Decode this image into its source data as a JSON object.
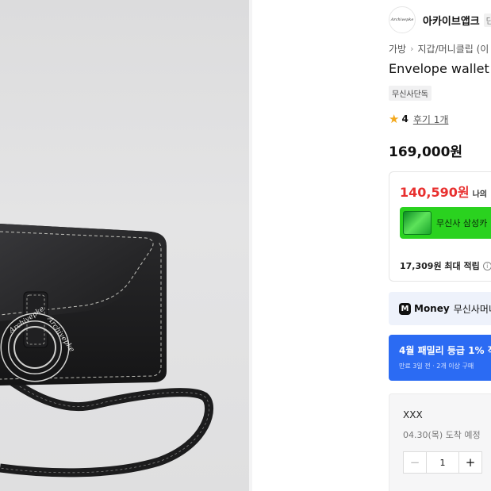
{
  "brand": {
    "name": "아카이브앱크",
    "badge": "단",
    "logo_text": "Archivepke"
  },
  "breadcrumb": {
    "first": "가방",
    "second": "지갑/머니클립 (이"
  },
  "product": {
    "title": "Envelope wallet",
    "exclusive_tag": "무신사단독",
    "rating": "4",
    "review_link": "후기 1개",
    "price": "169,000원"
  },
  "benefits": {
    "sale_price": "140,590원",
    "sale_note": "나의",
    "card_promo": "무신사 삼성카",
    "points": "17,309원 최대 적립"
  },
  "money": {
    "label": "Money",
    "text": "무신사머니"
  },
  "promo": {
    "title": "4월 패밀리 등급 1% 적",
    "subtitle": "만료 3일 전 · 2개 이상 구매"
  },
  "option": {
    "name": "XXX",
    "arrival": "04.30(목) 도착 예정",
    "quantity": "1"
  },
  "photo": {
    "ring_text": "Archivepke"
  },
  "colors": {
    "sale_red": "#e8302f",
    "promo_blue": "#2b6bf3",
    "card_green": "#2ad21f",
    "star": "#f3a81b"
  }
}
